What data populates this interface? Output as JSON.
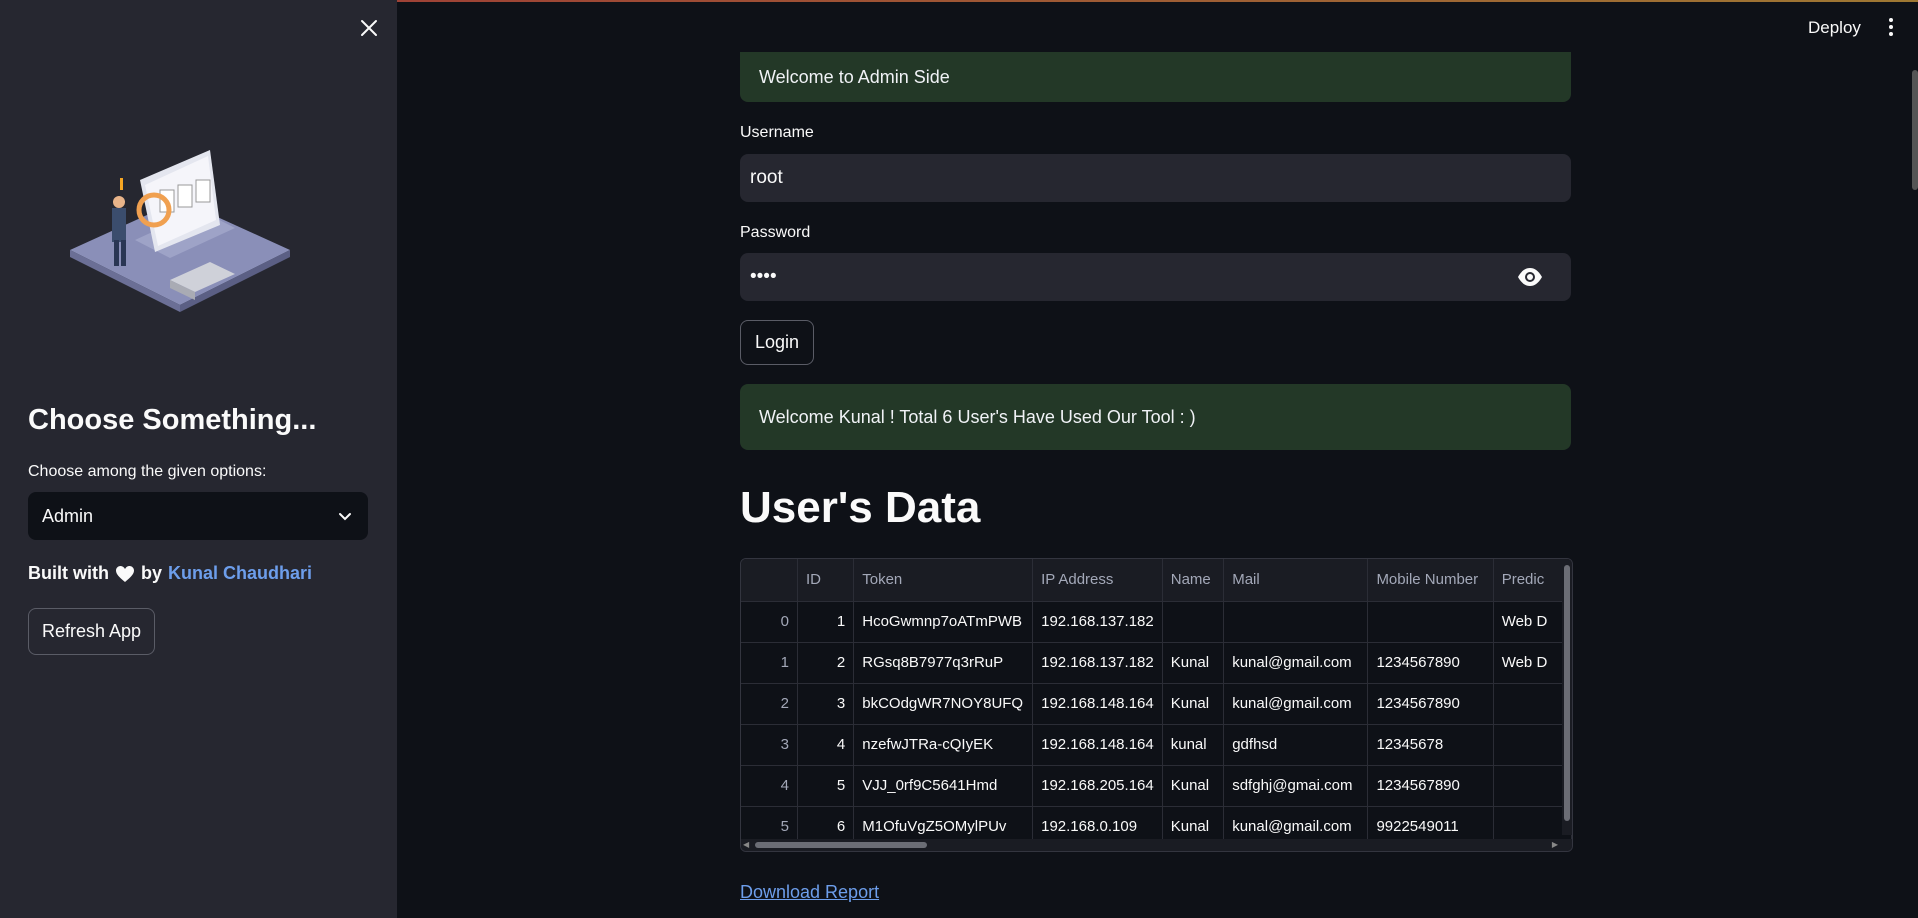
{
  "sidebar": {
    "title": "Choose Something...",
    "select_label": "Choose among the given options:",
    "select_value": "Admin",
    "built_prefix": "Built with",
    "built_by": "by",
    "author": "Kunal Chaudhari",
    "refresh_label": "Refresh App"
  },
  "header": {
    "deploy_label": "Deploy"
  },
  "main": {
    "welcome_admin": "Welcome to Admin Side",
    "username_label": "Username",
    "username_value": "root",
    "password_label": "Password",
    "password_value": "••••",
    "login_label": "Login",
    "welcome_user": "Welcome Kunal ! Total 6 User's Have Used Our Tool : )",
    "section_title": "User's Data",
    "download_label": "Download Report"
  },
  "table": {
    "columns": [
      "",
      "ID",
      "Token",
      "IP Address",
      "Name",
      "Mail",
      "Mobile Number",
      "Predic"
    ],
    "rows": [
      [
        "0",
        "1",
        "HcoGwmnp7oATmPWB",
        "192.168.137.182",
        "",
        "",
        "",
        "Web D"
      ],
      [
        "1",
        "2",
        "RGsq8B7977q3rRuP",
        "192.168.137.182",
        "Kunal",
        "kunal@gmail.com",
        "1234567890",
        "Web D"
      ],
      [
        "2",
        "3",
        "bkCOdgWR7NOY8UFQ",
        "192.168.148.164",
        "Kunal",
        "kunal@gmail.com",
        "1234567890",
        ""
      ],
      [
        "3",
        "4",
        "nzefwJTRa-cQIyEK",
        "192.168.148.164",
        "kunal",
        "gdfhsd",
        "12345678",
        ""
      ],
      [
        "4",
        "5",
        "VJJ_0rf9C5641Hmd",
        "192.168.205.164",
        "Kunal",
        "sdfghj@gmai.com",
        "1234567890",
        ""
      ],
      [
        "5",
        "6",
        "M1OfuVgZ5OMylPUv",
        "192.168.0.109",
        "Kunal",
        "kunal@gmail.com",
        "9922549011",
        ""
      ]
    ]
  },
  "colors": {
    "accent_link": "#6d9eeb",
    "alert_bg": "#233827",
    "sidebar_bg": "#262730",
    "page_bg": "#0e1117"
  },
  "icons": [
    "close-icon",
    "chevron-down-icon",
    "heart-icon",
    "eye-icon",
    "kebab-menu-icon"
  ]
}
